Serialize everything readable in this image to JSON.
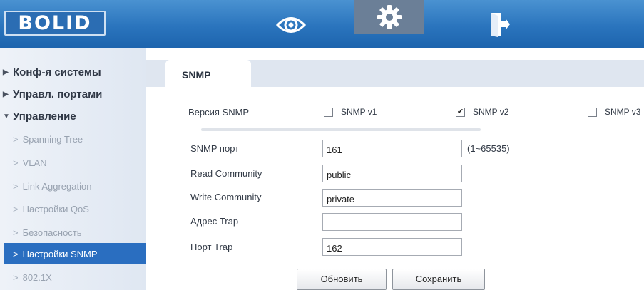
{
  "header": {
    "logo": "BOLID",
    "nav": [
      "eye-icon",
      "gear-icon",
      "exit-icon"
    ],
    "active_nav": "gear-icon"
  },
  "sidebar": {
    "items": [
      {
        "label": "Конф-я системы",
        "level": "top",
        "arrow": "▶"
      },
      {
        "label": "Управл. портами",
        "level": "top",
        "arrow": "▶"
      },
      {
        "label": "Управление",
        "level": "top",
        "arrow": "▼"
      },
      {
        "label": "Spanning Tree",
        "level": "sub"
      },
      {
        "label": "VLAN",
        "level": "sub"
      },
      {
        "label": "Link Aggregation",
        "level": "sub"
      },
      {
        "label": "Настройки QoS",
        "level": "sub"
      },
      {
        "label": "Безопасность",
        "level": "sub"
      },
      {
        "label": "Настройки SNMP",
        "level": "sub",
        "active": true
      },
      {
        "label": "802.1X",
        "level": "sub"
      }
    ],
    "chevron": ">"
  },
  "tab": {
    "label": "SNMP"
  },
  "form": {
    "version_label": "Версия SNMP",
    "versions": [
      {
        "label": "SNMP v1",
        "checked": false
      },
      {
        "label": "SNMP v2",
        "checked": true
      },
      {
        "label": "SNMP v3",
        "checked": false
      }
    ],
    "check_mark": "✔",
    "port": {
      "label": "SNMP порт",
      "value": "161",
      "hint": "(1~65535)"
    },
    "read_community": {
      "label": "Read Community",
      "value": "public"
    },
    "write_community": {
      "label": "Write Community",
      "value": "private"
    },
    "trap_address": {
      "label": "Адрес Trap",
      "value": ""
    },
    "trap_port": {
      "label": "Порт Trap",
      "value": "162"
    }
  },
  "buttons": {
    "refresh": "Обновить",
    "save": "Сохранить"
  },
  "colors": {
    "header": "#2a74bd",
    "active_item": "#2a6ec0",
    "sidebar": "#e8eef6"
  }
}
